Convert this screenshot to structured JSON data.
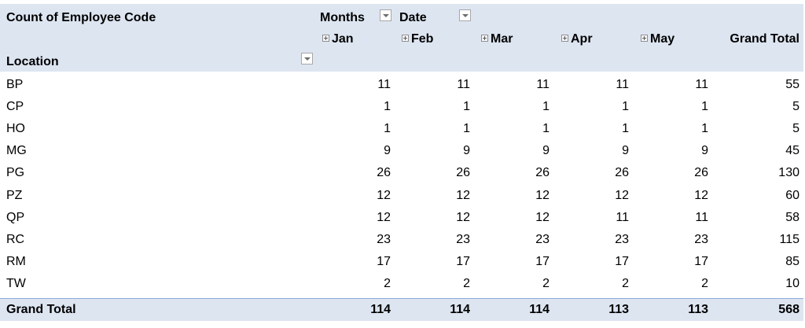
{
  "pivot": {
    "value_field": "Count of Employee Code",
    "column_field": "Months",
    "column_field2": "Date",
    "row_field": "Location",
    "columns": [
      "Jan",
      "Feb",
      "Mar",
      "Apr",
      "May"
    ],
    "grand_total_label": "Grand Total",
    "rows": [
      {
        "location": "BP",
        "values": [
          "11",
          "11",
          "11",
          "11",
          "11"
        ],
        "total": "55"
      },
      {
        "location": "CP",
        "values": [
          "1",
          "1",
          "1",
          "1",
          "1"
        ],
        "total": "5"
      },
      {
        "location": "HO",
        "values": [
          "1",
          "1",
          "1",
          "1",
          "1"
        ],
        "total": "5"
      },
      {
        "location": "MG",
        "values": [
          "9",
          "9",
          "9",
          "9",
          "9"
        ],
        "total": "45"
      },
      {
        "location": "PG",
        "values": [
          "26",
          "26",
          "26",
          "26",
          "26"
        ],
        "total": "130"
      },
      {
        "location": "PZ",
        "values": [
          "12",
          "12",
          "12",
          "12",
          "12"
        ],
        "total": "60"
      },
      {
        "location": "QP",
        "values": [
          "12",
          "12",
          "12",
          "11",
          "11"
        ],
        "total": "58"
      },
      {
        "location": "RC",
        "values": [
          "23",
          "23",
          "23",
          "23",
          "23"
        ],
        "total": "115"
      },
      {
        "location": "RM",
        "values": [
          "17",
          "17",
          "17",
          "17",
          "17"
        ],
        "total": "85"
      },
      {
        "location": "TW",
        "values": [
          "2",
          "2",
          "2",
          "2",
          "2"
        ],
        "total": "10"
      }
    ],
    "grand_total_row": {
      "values": [
        "114",
        "114",
        "114",
        "113",
        "113"
      ],
      "total": "568"
    }
  },
  "colors": {
    "header_fill": "#dde5f1",
    "total_border": "#8ea9db"
  }
}
